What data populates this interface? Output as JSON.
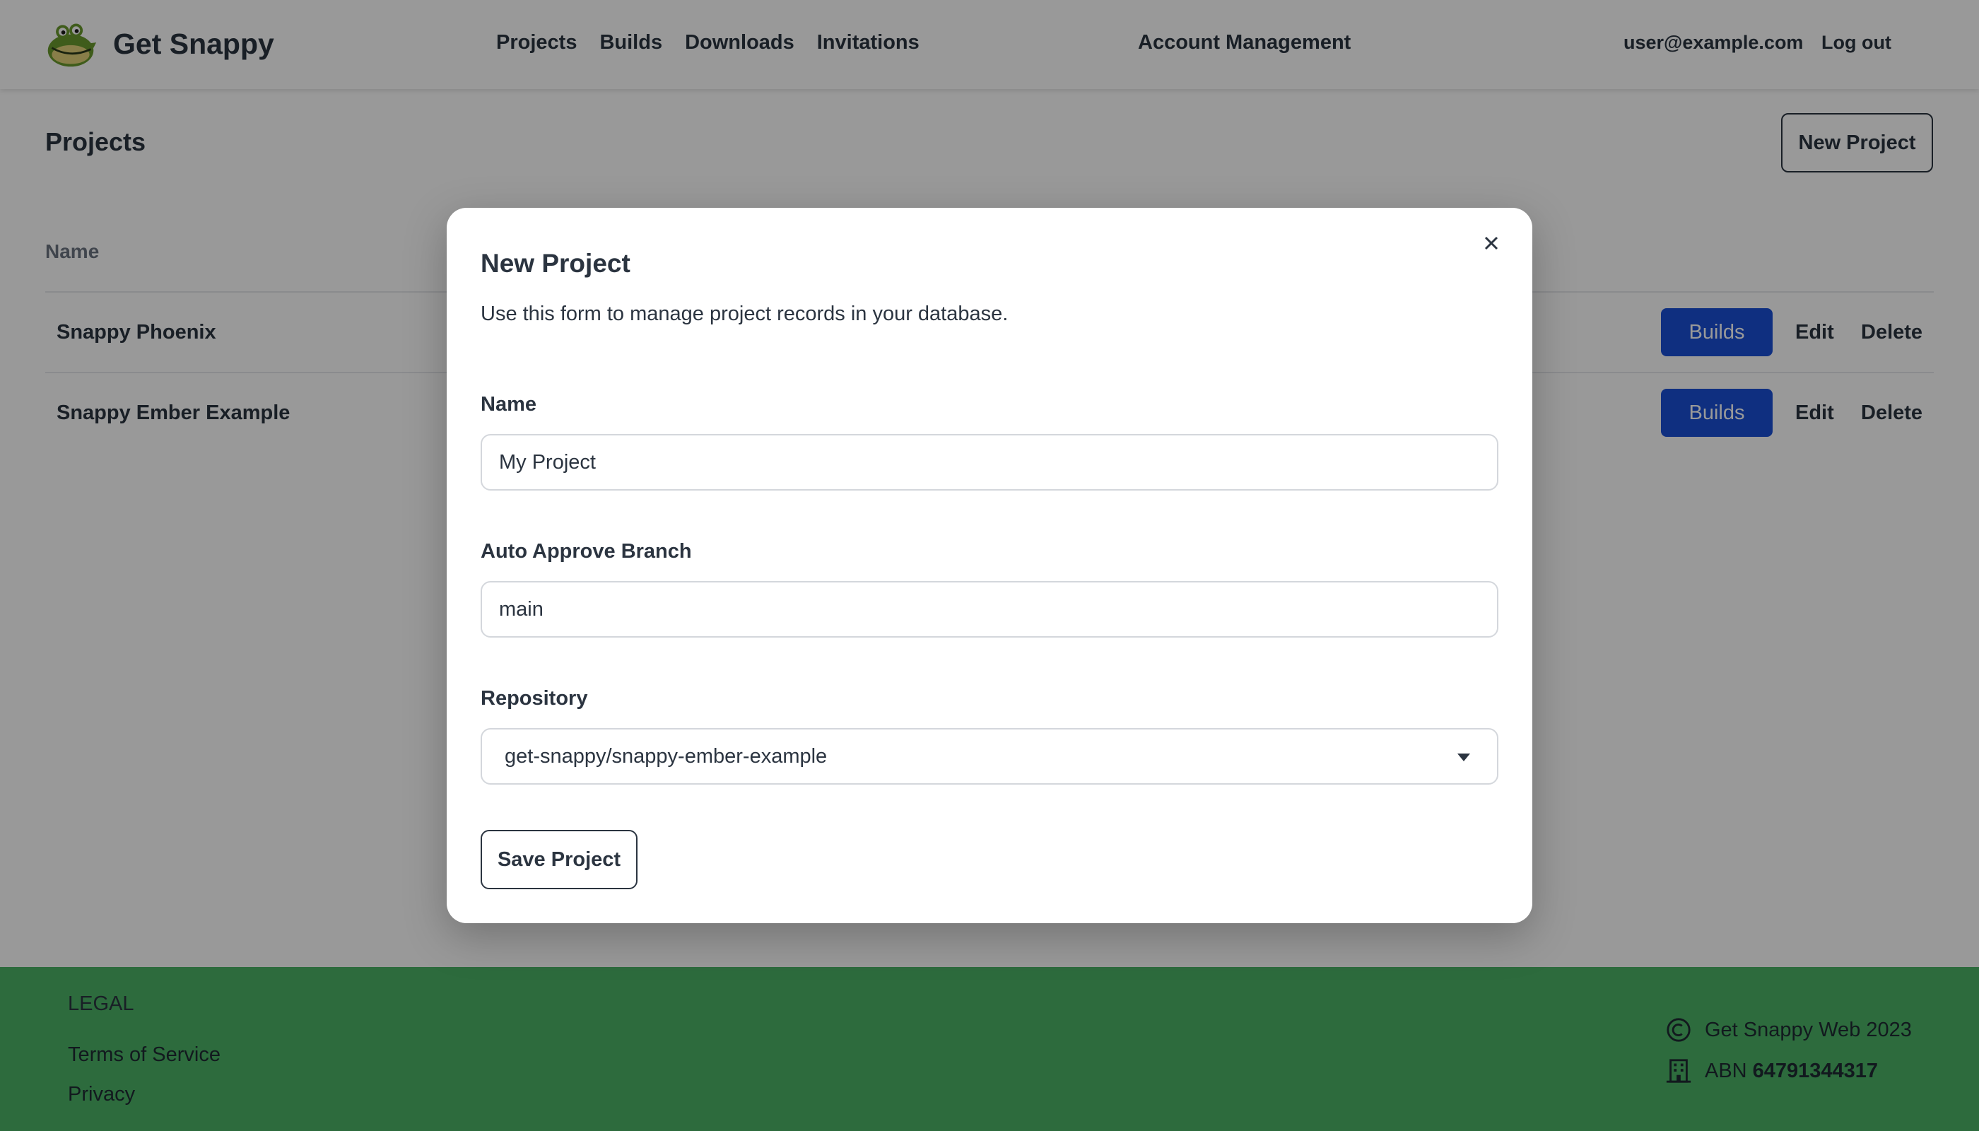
{
  "header": {
    "brand": "Get Snappy",
    "nav": [
      "Projects",
      "Builds",
      "Downloads",
      "Invitations"
    ],
    "account": "Account Management",
    "user_email": "user@example.com",
    "logout": "Log out"
  },
  "projects": {
    "title": "Projects",
    "new_button": "New Project",
    "column_name": "Name",
    "rows": [
      {
        "name": "Snappy Phoenix",
        "builds": "Builds",
        "edit": "Edit",
        "delete": "Delete"
      },
      {
        "name": "Snappy Ember Example",
        "builds": "Builds",
        "edit": "Edit",
        "delete": "Delete"
      }
    ]
  },
  "footer": {
    "legal_title": "LEGAL",
    "links": [
      "Terms of Service",
      "Privacy"
    ],
    "copyright": "Get Snappy Web 2023",
    "abn_label": "ABN",
    "abn_number": "64791344317"
  },
  "modal": {
    "title": "New Project",
    "description": "Use this form to manage project records in your database.",
    "fields": {
      "name": {
        "label": "Name",
        "value": "My Project"
      },
      "branch": {
        "label": "Auto Approve Branch",
        "value": "main"
      },
      "repository": {
        "label": "Repository",
        "value": "get-snappy/snappy-ember-example"
      }
    },
    "save": "Save Project"
  },
  "colors": {
    "accent": "#1a4fd6",
    "footer_bg": "#4bb266",
    "text": "#2b3440"
  },
  "icons": [
    "crocodile-logo-icon",
    "close-icon",
    "chevron-down-icon",
    "copyright-icon",
    "building-icon"
  ]
}
